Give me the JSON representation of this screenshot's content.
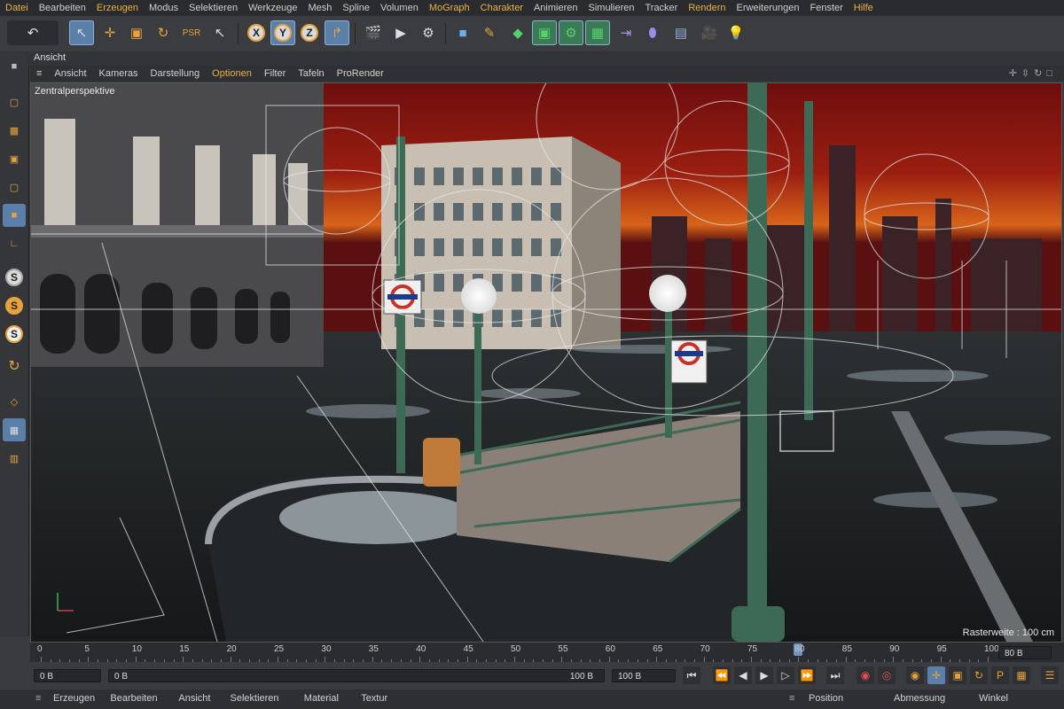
{
  "menu": [
    "Datei",
    "Bearbeiten",
    "Erzeugen",
    "Modus",
    "Selektieren",
    "Werkzeuge",
    "Mesh",
    "Spline",
    "Volumen",
    "MoGraph",
    "Charakter",
    "Animieren",
    "Simulieren",
    "Tracker",
    "Rendern",
    "Erweiterungen",
    "Fenster",
    "Hilfe"
  ],
  "accent_menu": [
    "Datei",
    "Erzeugen",
    "MoGraph",
    "Charakter",
    "Rendern",
    "Hilfe"
  ],
  "toolbar": {
    "undo_icon": "undo-icon",
    "live_selection_icon": "cursor-icon",
    "move_icon": "move-icon",
    "scale_icon": "scale-icon",
    "rotate_icon": "rotate-icon",
    "psr_icon": "psr-icon",
    "x_label": "X",
    "y_label": "Y",
    "z_label": "Z",
    "coord_icon": "coordinate-system-icon",
    "render_view_icon": "clapper-icon",
    "render_pv_icon": "render-play-icon",
    "render_settings_icon": "render-gear-icon",
    "cube_icon": "cube-icon",
    "pen_icon": "pen-icon",
    "subdivision_icon": "subdivision-icon",
    "array_icon": "array-icon",
    "generator_icon": "gear-cube-icon",
    "cloner_icon": "cloner-icon",
    "deformer_icon": "bend-icon",
    "field_icon": "capsule-icon",
    "floor_icon": "floor-icon",
    "camera_icon": "camera-icon",
    "light_icon": "light-bulb-icon"
  },
  "view_tab": "Ansicht",
  "view_menu": [
    "Ansicht",
    "Kameras",
    "Darstellung",
    "Optionen",
    "Filter",
    "Tafeln",
    "ProRender"
  ],
  "view_menu_active": "Optionen",
  "viewport": {
    "label": "Zentralperspektive",
    "raster": "Rasterweite : 100 cm"
  },
  "timeline": {
    "ticks": [
      "0",
      "5",
      "10",
      "15",
      "20",
      "25",
      "30",
      "35",
      "40",
      "45",
      "50",
      "55",
      "60",
      "65",
      "70",
      "75",
      "80",
      "85",
      "90",
      "95",
      "100"
    ],
    "current": "80",
    "current_frame": 80,
    "end_field": "80 B"
  },
  "fields": {
    "start": "0 B",
    "range_start": "0 B",
    "range_end": "100 B",
    "end": "100 B"
  },
  "bottom": {
    "left": [
      "Erzeugen",
      "Bearbeiten",
      "Ansicht",
      "Selektieren",
      "Material",
      "Textur"
    ],
    "right": [
      "Position",
      "Abmessung",
      "Winkel"
    ]
  },
  "colors": {
    "accent": "#e8b04a",
    "selected": "#5a7fa8",
    "sky_top": "#7a1010",
    "sky_glow": "#e07a1a",
    "lamp_green": "#3d6a55"
  }
}
